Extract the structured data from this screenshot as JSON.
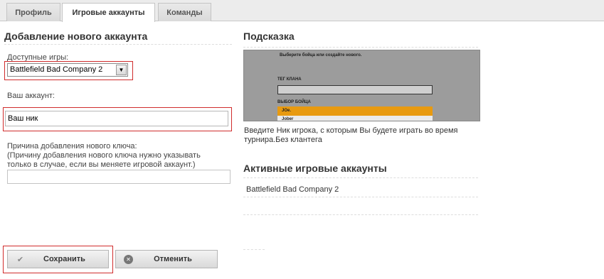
{
  "tabs": [
    {
      "label": "Профиль",
      "active": false
    },
    {
      "label": "Игровые аккаунты",
      "active": true
    },
    {
      "label": "Команды",
      "active": false
    }
  ],
  "add_account": {
    "title": "Добавление нового аккаунта",
    "games_label": "Доступные игры:",
    "games_selected": "Battlefield Bad Company 2",
    "account_label": "Ваш аккаунт:",
    "account_value": "Ваш ник",
    "reason_label": "Причина добавления нового ключа:\n(Причину добавления нового ключа нужно указывать только в случае, если вы меняете игровой аккаунт.)",
    "reason_value": ""
  },
  "buttons": {
    "save_label": "Сохранить",
    "cancel_label": "Отменить"
  },
  "hint": {
    "title": "Подсказка",
    "preview": {
      "line1": "Выберите бойца или создайте нового.",
      "clan_tag_label": "ТЕГ КЛАНА",
      "fighter_label": "ВЫБОР БОЙЦА",
      "list_selected": "JOe.",
      "list_next": "Jober"
    },
    "text": "Введите Ник игрока, с которым Вы будете играть во время турнира.Без клантега"
  },
  "active_accounts": {
    "title": "Активные игровые аккаунты",
    "items": [
      "Battlefield Bad Company 2"
    ]
  },
  "colors": {
    "highlight_box": "#d02c2c",
    "preview_selected": "#e89a10"
  },
  "icons": {
    "save": "checkmark-icon",
    "cancel": "close-circle-icon",
    "select": "chevron-down-icon"
  }
}
